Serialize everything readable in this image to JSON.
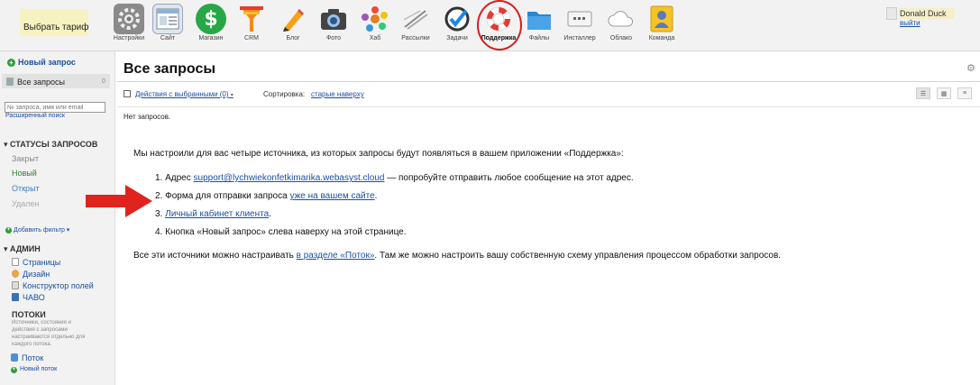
{
  "topbar": {
    "tariff_button": "Выбрать тариф",
    "apps": [
      {
        "label": "Настройки",
        "icon": "settings-gear-icon"
      },
      {
        "label": "Сайт",
        "icon": "site-icon"
      },
      {
        "label": "Магазин",
        "icon": "shop-dollar-icon"
      },
      {
        "label": "CRM",
        "icon": "crm-funnel-icon"
      },
      {
        "label": "Блог",
        "icon": "blog-pencil-icon"
      },
      {
        "label": "Фото",
        "icon": "photo-camera-icon"
      },
      {
        "label": "Хаб",
        "icon": "hub-icon"
      },
      {
        "label": "Рассылки",
        "icon": "mailer-icon"
      },
      {
        "label": "Задачи",
        "icon": "tasks-check-icon"
      },
      {
        "label": "Поддержка",
        "icon": "support-lifebuoy-icon"
      },
      {
        "label": "Файлы",
        "icon": "files-folder-icon"
      },
      {
        "label": "Инсталлер",
        "icon": "installer-icon"
      },
      {
        "label": "Облако",
        "icon": "cloud-icon"
      },
      {
        "label": "Команда",
        "icon": "team-icon"
      }
    ],
    "user_name": "Donald Duck",
    "logout": "выйти"
  },
  "sidebar": {
    "new_request": "Новый запрос",
    "all_requests": "Все запросы",
    "all_requests_count": "0",
    "search_placeholder": "№ запроса, имя или email",
    "advanced_search": "Расширенный поиск",
    "statuses_header": "СТАТУСЫ ЗАПРОСОВ",
    "statuses": [
      "Закрыт",
      "Новый",
      "Открыт",
      "Удален"
    ],
    "add_filter": "Добавить фильтр",
    "admin_header": "АДМИН",
    "admin_items": [
      "Страницы",
      "Дизайн",
      "Конструктор полей",
      "ЧАВО"
    ],
    "flows_header": "ПОТОКИ",
    "flows_hint_lines": [
      "Источники, состояния и",
      "действия с запросами",
      "настраиваются отдельно для",
      "каждого потока."
    ],
    "flow_item": "Поток",
    "new_flow": "Новый поток"
  },
  "main": {
    "title": "Все запросы",
    "actions_link": "Действия с выбранными (0)",
    "sort_label": "Сортировка:",
    "sort_value": "старые наверху",
    "no_requests": "Нет запросов.",
    "intro": "Мы настроили для вас четыре источника, из которых запросы будут появляться в вашем приложении «Поддержка»:",
    "item1_prefix": "1. Адрес ",
    "item1_link": "support@lychwiekonfetkimarika.webasyst.cloud",
    "item1_suffix": " — попробуйте отправить любое сообщение на этот адрес.",
    "item2_prefix": "2. Форма для отправки запроса ",
    "item2_link": "уже на вашем сайте",
    "item2_suffix": ".",
    "item3_prefix": "3. ",
    "item3_link": "Личный кабинет клиента",
    "item3_suffix": ".",
    "item4": "4. Кнопка «Новый запрос» слева наверху на этой странице.",
    "outro_prefix": "Все эти источники можно настраивать ",
    "outro_link": "в разделе «Поток»",
    "outro_suffix": ". Там же можно настроить вашу собственную схему управления процессом обработки запросов."
  },
  "colors": {
    "link": "#1a4fa3",
    "annotation_red": "#e0231c",
    "sidebar_bg": "#f2f2f2",
    "new_status": "#2e7d32"
  }
}
